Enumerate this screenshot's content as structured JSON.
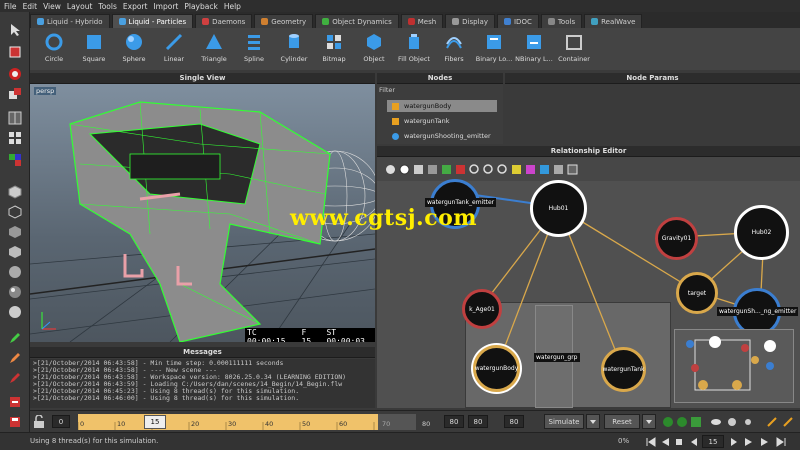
{
  "menu": [
    "File",
    "Edit",
    "View",
    "Layout",
    "Tools",
    "Export",
    "Import",
    "Playback",
    "Help"
  ],
  "tabs": [
    {
      "label": "Liquid - Hybrido",
      "color": "#4aa0e0"
    },
    {
      "label": "Liquid - Particles",
      "color": "#4aa0e0",
      "active": true
    },
    {
      "label": "Daemons",
      "color": "#d04040"
    },
    {
      "label": "Geometry",
      "color": "#d08030"
    },
    {
      "label": "Object Dynamics",
      "color": "#40b040"
    },
    {
      "label": "Mesh",
      "color": "#c03030"
    },
    {
      "label": "Display",
      "color": "#999999"
    },
    {
      "label": "IDOC",
      "color": "#4080d0"
    },
    {
      "label": "Tools",
      "color": "#888888"
    },
    {
      "label": "RealWave",
      "color": "#40a0c0"
    }
  ],
  "shelf_tools": [
    "Circle",
    "Square",
    "Sphere",
    "Linear",
    "Triangle",
    "Spline",
    "Cylinder",
    "Bitmap",
    "Object",
    "Fill Object",
    "Fibers",
    "Binary Lo...",
    "NBinary L...",
    "Container"
  ],
  "panels": {
    "single_view": "Single View",
    "nodes": "Nodes",
    "node_params": "Node Params",
    "relationship_editor": "Relationship Editor",
    "messages": "Messages"
  },
  "viewport": {
    "camera_tag": "persp",
    "tc": "TC 00:00:15",
    "frame": "F 15",
    "st": "ST 00:00:03"
  },
  "nodes_panel": {
    "filter_label": "Filter",
    "items": [
      "watergunBody",
      "watergunTank",
      "watergunShooting_emitter"
    ]
  },
  "graph_nodes": {
    "tank_emitter": "watergunTank_emitter",
    "hub01": "Hub01",
    "gravity01": "Gravity01",
    "hub02": "Hub02",
    "target": "target",
    "shooting_emitter": "watergunSh..._ng_emitter",
    "age01": "k_Age01",
    "body": "watergunBody",
    "grp": "watergun_grp",
    "tank": "watergunTank"
  },
  "messages": [
    ">[21/October/2014 06:43:58] - Min time step: 0.000111111 seconds",
    ">[21/October/2014 06:43:58] - --- New scene ---",
    ">[21/October/2014 06:43:58] - Workspace version: 8026.25.0.34 (LEARNING EDITION)",
    ">[21/October/2014 06:43:59] - Loading C:/Users/dan/scenes/14_Begin/14_Begin.flw",
    ">[21/October/2014 06:45:23] - Using 8 thread(s) for this simulation.",
    ">[21/October/2014 06:46:00] - Using 8 thread(s) for this simulation."
  ],
  "timeline": {
    "start": "0",
    "current": "15",
    "ticks": [
      "0",
      "10",
      "20",
      "30",
      "40",
      "50",
      "60",
      "70",
      "80"
    ],
    "end_field": "80",
    "end_field2": "80",
    "range_end": "80",
    "simulate": "Simulate",
    "reset": "Reset"
  },
  "status": {
    "text": "Using 8 thread(s) for this simulation.",
    "progress": "0%",
    "frame": "15"
  },
  "watermark": "www.cgtsj.com"
}
